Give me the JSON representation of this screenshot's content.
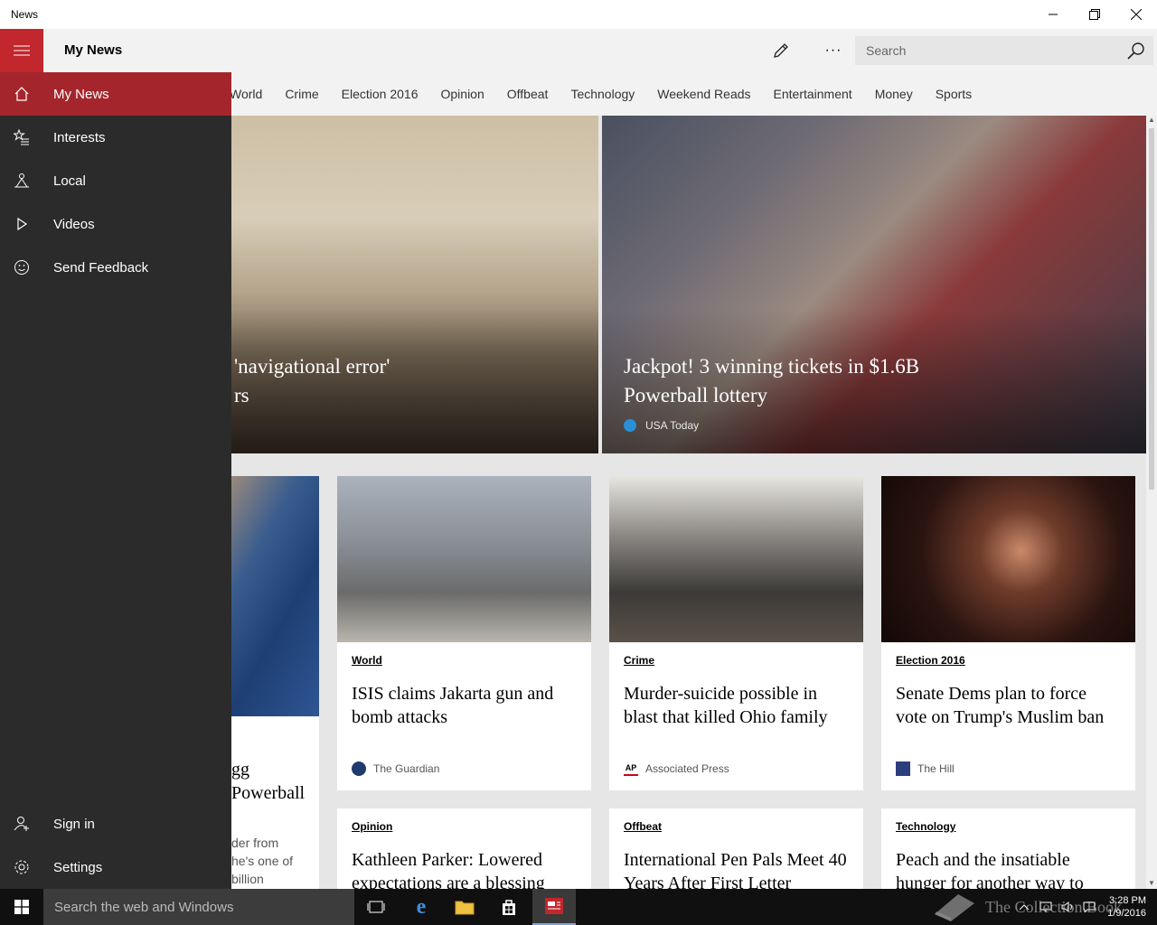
{
  "window": {
    "title": "News"
  },
  "header": {
    "page_title": "My News",
    "search_placeholder": "Search"
  },
  "categories": [
    "World",
    "Crime",
    "Election 2016",
    "Opinion",
    "Offbeat",
    "Technology",
    "Weekend Reads",
    "Entertainment",
    "Money",
    "Sports"
  ],
  "nav": {
    "items": [
      {
        "label": "My News",
        "icon": "home-icon",
        "active": true
      },
      {
        "label": "Interests",
        "icon": "interests-star-icon"
      },
      {
        "label": "Local",
        "icon": "local-icon"
      },
      {
        "label": "Videos",
        "icon": "play-icon"
      },
      {
        "label": "Send Feedback",
        "icon": "smiley-icon"
      }
    ],
    "bottom": [
      {
        "label": "Sign in",
        "icon": "person-icon"
      },
      {
        "label": "Settings",
        "icon": "gear-icon"
      }
    ]
  },
  "hero": {
    "left": {
      "headline_line1": "'navigational error'",
      "headline_line2": "rs"
    },
    "right": {
      "headline": "Jackpot! 3 winning tickets in $1.6B Powerball lottery",
      "source": "USA Today"
    }
  },
  "partial_card": {
    "title_line1": "gg",
    "title_line2": "Powerball",
    "text_line1": "der from",
    "text_line2": "he's one of",
    "text_line3": "billion"
  },
  "cards": [
    {
      "category": "World",
      "title": "ISIS claims Jakarta gun and bomb attacks",
      "source": "The Guardian"
    },
    {
      "category": "Crime",
      "title": "Murder-suicide possible in blast that killed Ohio family",
      "source": "Associated Press",
      "logo_text": "AP"
    },
    {
      "category": "Election 2016",
      "title": "Senate Dems plan to force vote on Trump's Muslim ban",
      "source": "The Hill"
    }
  ],
  "cards_row2": [
    {
      "category": "Opinion",
      "title": "Kathleen Parker: Lowered expectations are a blessing"
    },
    {
      "category": "Offbeat",
      "title": "International Pen Pals Meet 40 Years After First Letter"
    },
    {
      "category": "Technology",
      "title": "Peach and the insatiable hunger for another way to"
    }
  ],
  "taskbar": {
    "search_placeholder": "Search the web and Windows",
    "time": "3:28 PM",
    "date": "1/9/2016",
    "watermark": "The Collection Book"
  },
  "colors": {
    "accent": "#c1272d",
    "nav_bg": "#2b2b2b",
    "active_nav": "#a4262c"
  }
}
